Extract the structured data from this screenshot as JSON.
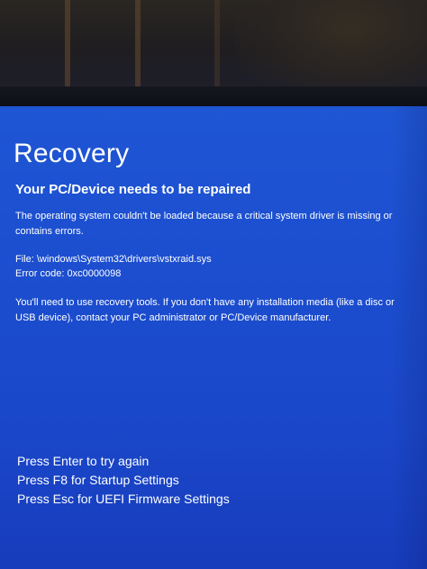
{
  "recovery": {
    "title": "Recovery",
    "subtitle": "Your PC/Device needs to be repaired",
    "message": "The operating system couldn't be loaded because a critical system driver is missing or contains errors.",
    "file_line": "File: \\windows\\System32\\drivers\\vstxraid.sys",
    "error_line": "Error code: 0xc0000098",
    "advice": "You'll need to use recovery tools. If you don't have any installation media (like a disc or USB device), contact your PC administrator or PC/Device manufacturer.",
    "options": [
      {
        "label": "Press Enter to try again"
      },
      {
        "label": "Press F8 for Startup Settings"
      },
      {
        "label": "Press Esc for UEFI Firmware Settings"
      }
    ]
  },
  "colors": {
    "screen_background": "#1c4fd0",
    "text": "#ffffff"
  }
}
